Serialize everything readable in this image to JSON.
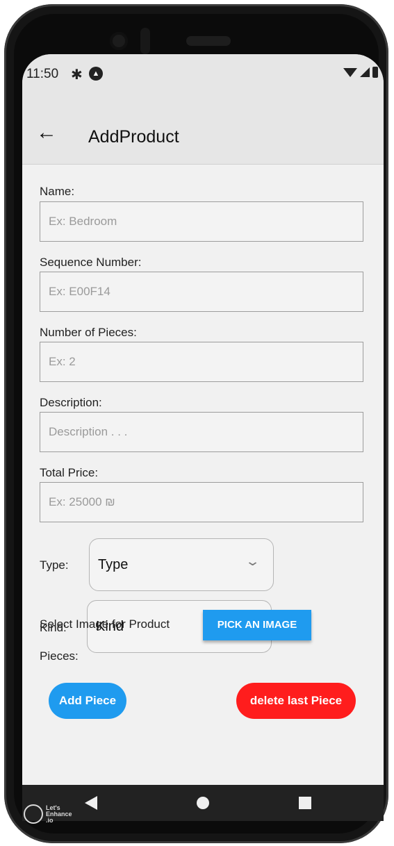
{
  "status_bar": {
    "time": "11:50",
    "settings_icon": "gear-icon",
    "nav_icon": "navigation-arrow-icon"
  },
  "app_bar": {
    "title": "AddProduct",
    "back_icon": "arrow-left-icon"
  },
  "form": {
    "name": {
      "label": "Name:",
      "placeholder": "Ex: Bedroom",
      "value": ""
    },
    "sequence": {
      "label": "Sequence Number:",
      "placeholder": "Ex: E00F14",
      "value": ""
    },
    "pieces_count": {
      "label": "Number of Pieces:",
      "placeholder": "Ex: 2",
      "value": ""
    },
    "description": {
      "label": "Description:",
      "placeholder": "Description . . .",
      "value": ""
    },
    "total_price": {
      "label": "Total Price:",
      "placeholder": "Ex: 25000 ₪",
      "value": ""
    },
    "type": {
      "label": "Type:",
      "selected": "Type"
    },
    "kind": {
      "label": "Kind:",
      "selected": "Kind"
    },
    "image": {
      "label": "Select Image for Product",
      "button": "PICK AN IMAGE"
    },
    "pieces": {
      "label": "Pieces:"
    },
    "add_piece_button": "Add Piece",
    "delete_piece_button": "delete last Piece"
  },
  "watermark": "Let's\nEnhance\n.io",
  "colors": {
    "primary": "#1f9bef",
    "danger": "#ff1d1d",
    "background": "#f1f1f1",
    "app_bar": "#e6e6e6"
  }
}
